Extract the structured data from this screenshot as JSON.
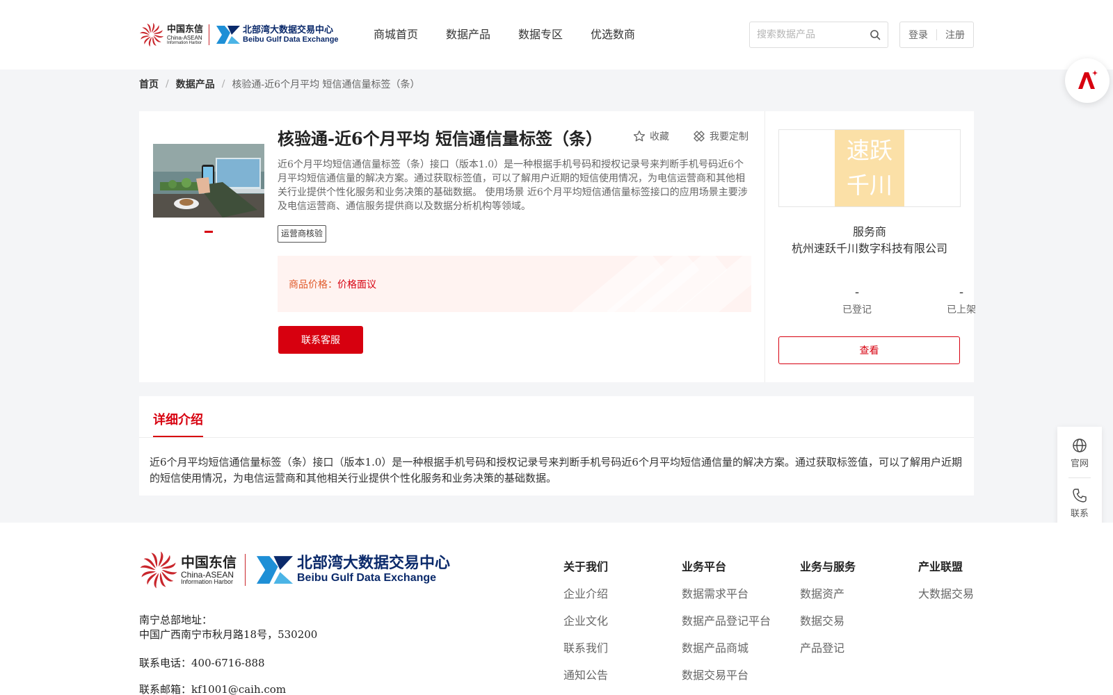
{
  "header": {
    "logo": {
      "cn_line1": "中国东信",
      "cn_line2": "China-ASEAN",
      "cn_line3": "Information Harbor",
      "bg_line1": "北部湾大数据交易中心",
      "bg_line2": "Beibu Gulf Data Exchange"
    },
    "nav": [
      "商城首页",
      "数据产品",
      "数据专区",
      "优选数商"
    ],
    "search_placeholder": "搜索数据产品",
    "login": "登录",
    "register": "注册"
  },
  "breadcrumb": {
    "home": "首页",
    "products": "数据产品",
    "current": "核验通-近6个月平均 短信通信量标签（条）",
    "separator": "/"
  },
  "product": {
    "title": "核验通-近6个月平均 短信通信量标签（条）",
    "favorite": "收藏",
    "customize": "我要定制",
    "description": "近6个月平均短信通信量标签（条）接口（版本1.0）是一种根据手机号码和授权记录号来判断手机号码近6个月平均短信通信量的解决方案。通过获取标签值，可以了解用户近期的短信使用情况，为电信运营商和其他相关行业提供个性化服务和业务决策的基础数据。 使用场景 近6个月平均短信通信量标签接口的应用场景主要涉及电信运营商、通信服务提供商以及数据分析机构等领域。",
    "tag": "运营商核验",
    "price_label": "商品价格：",
    "price_value": "价格面议",
    "contact_button": "联系客服"
  },
  "vendor": {
    "logo_line1": "速跃",
    "logo_line2": "千川",
    "role": "服务商",
    "name": "杭州速跃千川数字科技有限公司",
    "registered_count": "-",
    "registered_label": "已登记",
    "listed_count": "-",
    "listed_label": "已上架",
    "view_button": "查看"
  },
  "detail": {
    "tab": "详细介绍",
    "body": "近6个月平均短信通信量标签（条）接口（版本1.0）是一种根据手机号码和授权记录号来判断手机号码近6个月平均短信通信量的解决方案。通过获取标签值，可以了解用户近期的短信使用情况，为电信运营商和其他相关行业提供个性化服务和业务决策的基础数据。"
  },
  "floating": {
    "website": "官网",
    "contact": "联系"
  },
  "footer": {
    "address_label": "南宁总部地址：",
    "address": "中国广西南宁市秋月路18号，530200",
    "phone": "联系电话：400-6716-888",
    "email": "联系邮箱：kf1001@caih.com",
    "columns": [
      {
        "title": "关于我们",
        "items": [
          "企业介绍",
          "企业文化",
          "联系我们",
          "通知公告"
        ]
      },
      {
        "title": "业务平台",
        "items": [
          "数据需求平台",
          "数据产品登记平台",
          "数据产品商城",
          "数据交易平台"
        ]
      },
      {
        "title": "业务与服务",
        "items": [
          "数据资产",
          "数据交易",
          "产品登记"
        ]
      },
      {
        "title": "产业联盟",
        "items": [
          "大数据交易"
        ]
      }
    ]
  },
  "colors": {
    "accent": "#d7000f",
    "price_bg": "#fff3f1",
    "vendor_logo_bg": "#fbe0a7",
    "page_bg": "#f4f5f7"
  }
}
